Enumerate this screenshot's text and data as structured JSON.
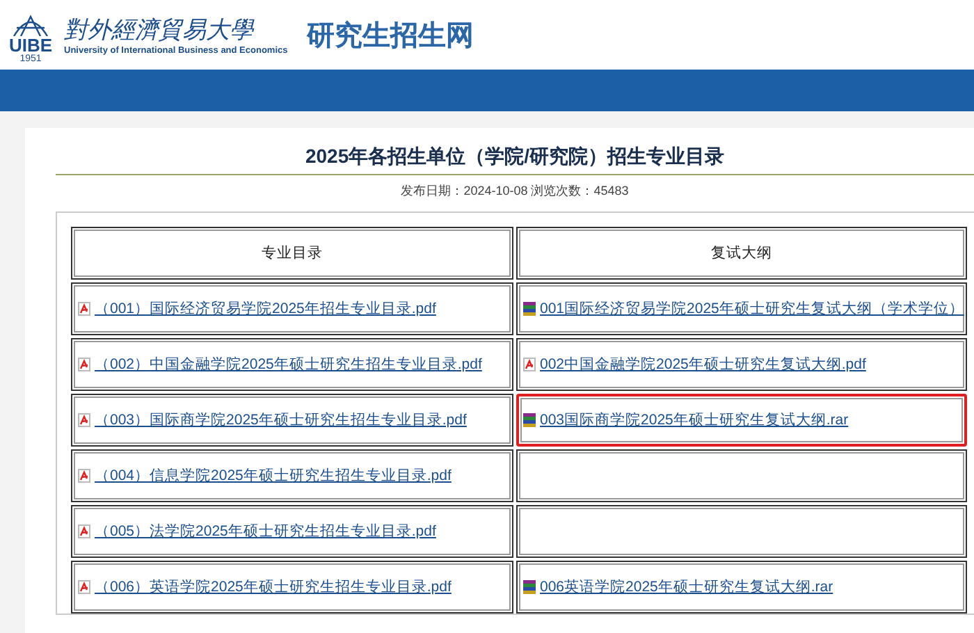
{
  "header": {
    "emblem_text": "UIBE",
    "emblem_year": "1951",
    "university_name": "對外經濟貿易大學",
    "university_name_en": "University of International Business and Economics",
    "site_title": "研究生招生网"
  },
  "article": {
    "title": "2025年各招生单位（学院/研究院）招生专业目录",
    "meta": "发布日期：2024-10-08 浏览次数：45483"
  },
  "table": {
    "columns": [
      "专业目录",
      "复试大纲"
    ],
    "rows": [
      {
        "catalog": {
          "kind": "pdf",
          "text": "（001）国际经济贸易学院2025年招生专业目录.pdf"
        },
        "syllabus": {
          "kind": "rar",
          "text": "001国际经济贸易学院2025年硕士研究生复试大纲（学术学位）"
        },
        "highlighted": false
      },
      {
        "catalog": {
          "kind": "pdf",
          "text": "（002）中国金融学院2025年硕士研究生招生专业目录.pdf"
        },
        "syllabus": {
          "kind": "pdf",
          "text": "002中国金融学院2025年硕士研究生复试大纲.pdf"
        },
        "highlighted": false
      },
      {
        "catalog": {
          "kind": "pdf",
          "text": "（003）国际商学院2025年硕士研究生招生专业目录.pdf"
        },
        "syllabus": {
          "kind": "rar",
          "text": "003国际商学院2025年硕士研究生复试大纲.rar"
        },
        "highlighted": true
      },
      {
        "catalog": {
          "kind": "pdf",
          "text": "（004）信息学院2025年硕士研究生招生专业目录.pdf"
        },
        "highlighted": false
      },
      {
        "catalog": {
          "kind": "pdf",
          "text": "（005）法学院2025年硕士研究生招生专业目录.pdf"
        },
        "highlighted": false
      },
      {
        "catalog": {
          "kind": "pdf",
          "text": "（006）英语学院2025年硕士研究生招生专业目录.pdf"
        },
        "syllabus": {
          "kind": "rar",
          "text": "006英语学院2025年硕士研究生复试大纲.rar"
        },
        "highlighted": false
      }
    ]
  }
}
